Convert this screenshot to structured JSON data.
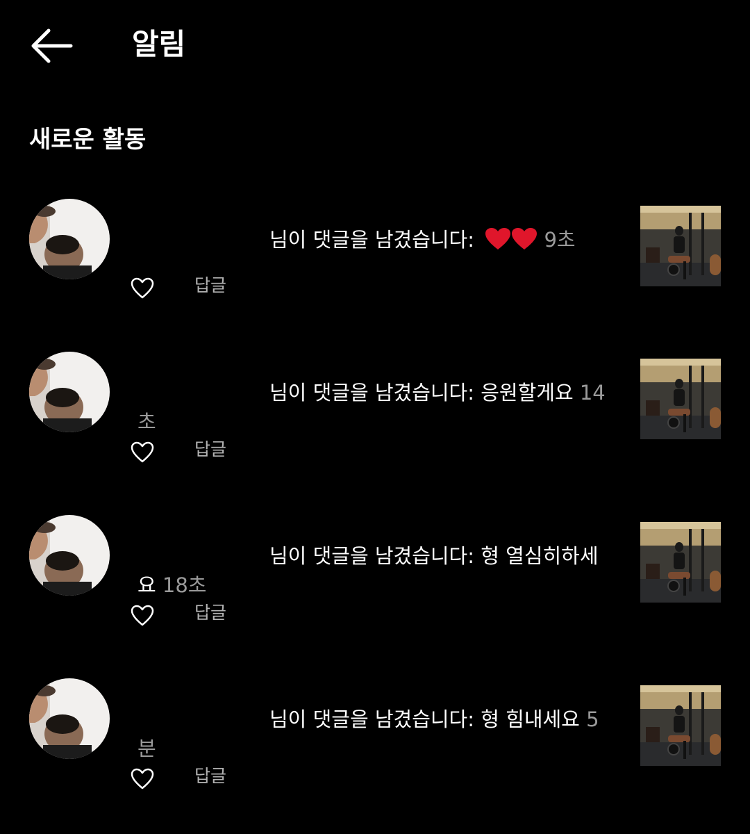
{
  "header": {
    "title": "알림",
    "back_icon": "arrow-left-icon"
  },
  "section": {
    "title": "새로운 활동"
  },
  "notifications": [
    {
      "message": "님이 댓글을 남겼습니다: ",
      "comment": "",
      "hearts": "❤️❤️",
      "time": "9초",
      "reply_label": "답글",
      "like_icon": "heart-outline-icon"
    },
    {
      "message": "님이 댓글을 남겼습니다: ",
      "comment": "응원할게요 ",
      "time": "14초",
      "reply_label": "답글",
      "like_icon": "heart-outline-icon"
    },
    {
      "message": "님이 댓글을 남겼습니다: ",
      "comment": "형 열심히하세요 ",
      "time": "18초",
      "reply_label": "답글",
      "like_icon": "heart-outline-icon"
    },
    {
      "message": "님이 댓글을 남겼습니다: ",
      "comment": "형 힘내세요 ",
      "time": "5분",
      "reply_label": "답글",
      "like_icon": "heart-outline-icon"
    }
  ],
  "colors": {
    "background": "#000000",
    "text": "#ffffff",
    "secondary_text": "#9a9a9a",
    "heart": "#e0162b"
  }
}
